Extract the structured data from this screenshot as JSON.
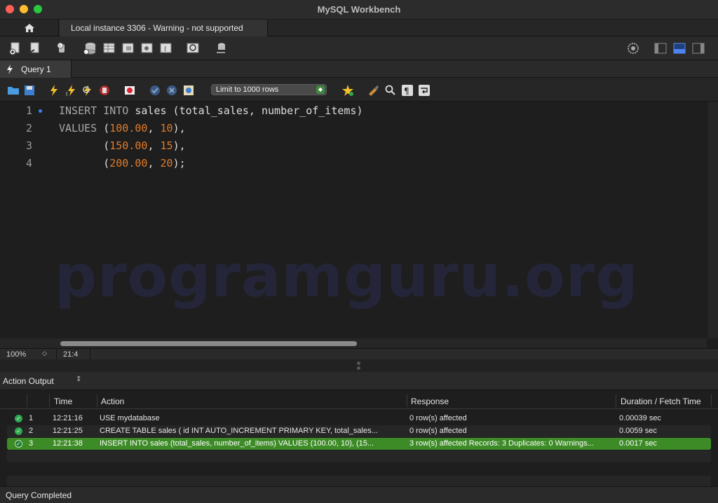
{
  "window": {
    "title": "MySQL Workbench"
  },
  "connection_tab": {
    "label": "Local instance 3306 - Warning - not supported"
  },
  "query_tab": {
    "label": "Query 1"
  },
  "sql_toolbar": {
    "limit_select": "Limit to 1000 rows"
  },
  "editor": {
    "line_numbers": [
      "1",
      "2",
      "3",
      "4"
    ],
    "lines": [
      [
        {
          "t": "INSERT INTO",
          "c": "kw"
        },
        {
          "t": " sales (total_sales, number_of_items)",
          "c": ""
        }
      ],
      [
        {
          "t": "VALUES",
          "c": "kw"
        },
        {
          "t": " (",
          "c": ""
        },
        {
          "t": "100.00",
          "c": "num"
        },
        {
          "t": ", ",
          "c": ""
        },
        {
          "t": "10",
          "c": "num"
        },
        {
          "t": "),",
          "c": ""
        }
      ],
      [
        {
          "t": "       (",
          "c": ""
        },
        {
          "t": "150.00",
          "c": "num"
        },
        {
          "t": ", ",
          "c": ""
        },
        {
          "t": "15",
          "c": "num"
        },
        {
          "t": "),",
          "c": ""
        }
      ],
      [
        {
          "t": "       (",
          "c": ""
        },
        {
          "t": "200.00",
          "c": "num"
        },
        {
          "t": ", ",
          "c": ""
        },
        {
          "t": "20",
          "c": "num"
        },
        {
          "t": ");",
          "c": ""
        }
      ]
    ],
    "watermark": "programguru.org",
    "zoom": "100%",
    "cursor_position": "21:4"
  },
  "output": {
    "panel_label": "Action Output",
    "columns": [
      "Time",
      "Action",
      "Response",
      "Duration / Fetch Time"
    ],
    "rows": [
      {
        "num": "1",
        "time": "12:21:16",
        "action": "USE mydatabase",
        "response": "0 row(s) affected",
        "duration": "0.00039 sec",
        "selected": false
      },
      {
        "num": "2",
        "time": "12:21:25",
        "action": "CREATE TABLE sales (     id INT AUTO_INCREMENT PRIMARY KEY,     total_sales...",
        "response": "0 row(s) affected",
        "duration": "0.0059 sec",
        "selected": false
      },
      {
        "num": "3",
        "time": "12:21:38",
        "action": "INSERT INTO sales (total_sales, number_of_items) VALUES (100.00, 10),        (15...",
        "response": "3 row(s) affected Records: 3  Duplicates: 0  Warnings...",
        "duration": "0.0017 sec",
        "selected": true
      }
    ]
  },
  "status": {
    "text": "Query Completed"
  },
  "colors": {
    "selected_row": "#3d8b27",
    "number": "#e07b2a",
    "keyword": "#a8a8a8",
    "marker": "#3b82f6"
  }
}
